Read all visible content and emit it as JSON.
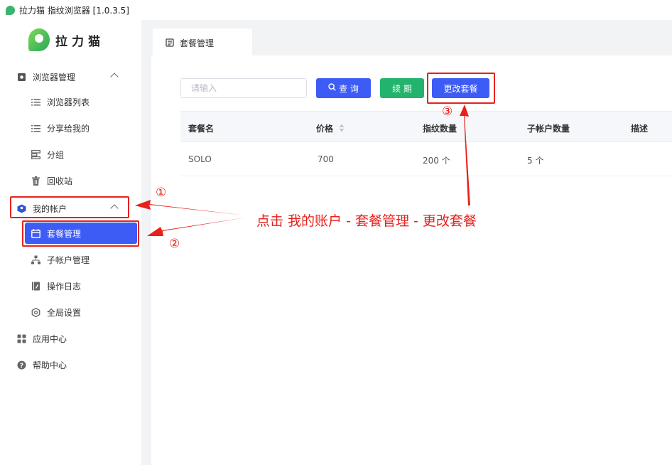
{
  "window": {
    "title": "拉力猫 指纹浏览器  [1.0.3.5]"
  },
  "brand": {
    "name": "拉力猫"
  },
  "sidebar": {
    "browser_group": "浏览器管理",
    "browser_list": "浏览器列表",
    "shared_with_me": "分享给我的",
    "groups": "分组",
    "recycle_bin": "回收站",
    "account_group": "我的帐户",
    "plan_management": "套餐管理",
    "sub_account_management": "子帐户管理",
    "operation_log": "操作日志",
    "global_settings": "全局设置",
    "app_center": "应用中心",
    "help_center": "帮助中心"
  },
  "tabs": [
    {
      "label": "套餐管理",
      "active": true
    }
  ],
  "toolbar": {
    "search_placeholder": "请输入",
    "query_label": "查 询",
    "renew_label": "续 期",
    "change_plan_label": "更改套餐"
  },
  "table": {
    "columns": [
      "套餐名",
      "价格",
      "指纹数量",
      "子帐户数量",
      "描述"
    ],
    "rows": [
      {
        "name": "SOLO",
        "price": "700",
        "fingerprints": "200 个",
        "sub_accounts": "5 个",
        "description": ""
      }
    ]
  },
  "annotations": {
    "step1": "①",
    "step2": "②",
    "step3": "③",
    "instruction": "点击 我的账户 - 套餐管理 - 更改套餐"
  },
  "colors": {
    "primary": "#3d5bf5",
    "success": "#22b46c",
    "annotation": "#e8211c"
  }
}
